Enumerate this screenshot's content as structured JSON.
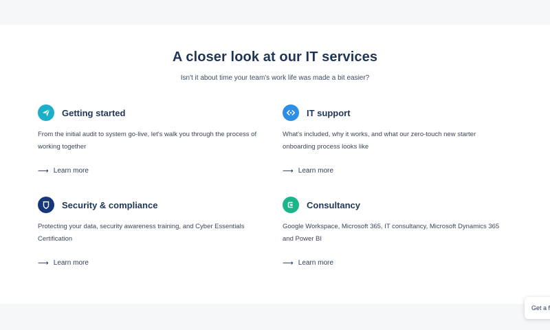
{
  "section": {
    "title": "A closer look at our IT services",
    "subtitle": "Isn't it about time your team's work life was made a bit easier?"
  },
  "cards": [
    {
      "title": "Getting started",
      "description": "From the initial audit to system go-live, let's walk you through the process of working together",
      "link": "Learn more",
      "icon": "paper-plane-icon",
      "color": "#1bb0c7"
    },
    {
      "title": "IT support",
      "description": "What's included, why it works, and what our zero-touch new starter onboarding process looks like",
      "link": "Learn more",
      "icon": "code-brackets-icon",
      "color": "#2d8ee6"
    },
    {
      "title": "Security & compliance",
      "description": "Protecting your data, security awareness training, and Cyber Essentials Certification",
      "link": "Learn more",
      "icon": "shield-icon",
      "color": "#16387a"
    },
    {
      "title": "Consultancy",
      "description": "Google Workspace, Microsoft 365, IT consultancy, Microsoft Dynamics 365 and Power BI",
      "link": "Learn more",
      "icon": "consultancy-icon",
      "color": "#1bb58c"
    }
  ],
  "floating": {
    "label": "Get a f"
  }
}
